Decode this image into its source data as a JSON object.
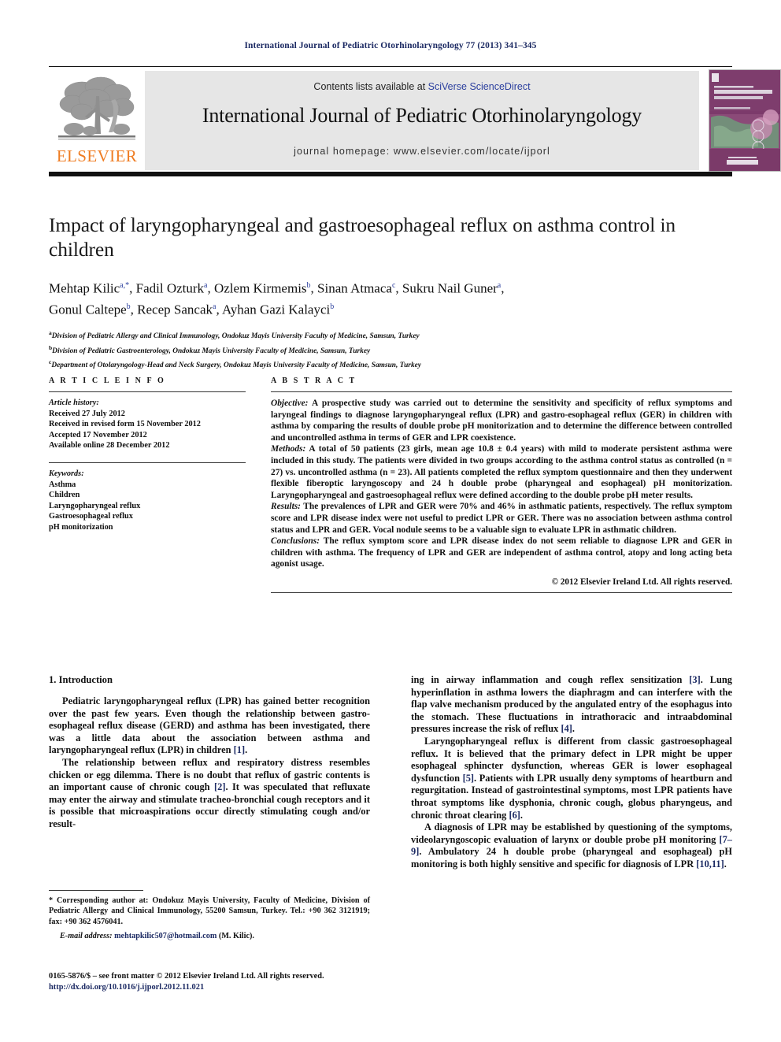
{
  "running_head": "International Journal of Pediatric Otorhinolaryngology 77 (2013) 341–345",
  "masthead": {
    "contents_prefix": "Contents lists available at ",
    "contents_link": "SciVerse ScienceDirect",
    "journal_title": "International Journal of Pediatric Otorhinolaryngology",
    "homepage": "journal homepage: www.elsevier.com/locate/ijporl",
    "publisher_wordmark": "ELSEVIER",
    "publisher_color": "#ef7c22",
    "link_color": "#2b3f9e",
    "band_color": "#e6e6e6",
    "cover_alt": "Pediatric Otorhinolaryngology journal cover"
  },
  "article": {
    "title": "Impact of laryngopharyngeal and gastroesophageal reflux on asthma control in children",
    "authors_line_1": "Mehtap Kilic a,*, Fadil Ozturk a, Ozlem Kirmemis b, Sinan Atmaca c, Sukru Nail Guner a,",
    "authors_line_2": "Gonul Caltepe b, Recep Sancak a, Ayhan Gazi Kalayci b",
    "affiliations": [
      "a Division of Pediatric Allergy and Clinical Immunology, Ondokuz Mayis University Faculty of Medicine, Samsun, Turkey",
      "b Division of Pediatric Gastroenterology, Ondokuz Mayis University Faculty of Medicine, Samsun, Turkey",
      "c Department of Otolaryngology-Head and Neck Surgery, Ondokuz Mayis University Faculty of Medicine, Samsun, Turkey"
    ]
  },
  "article_info": {
    "heading": "A R T I C L E   I N F O",
    "history_label": "Article history:",
    "history": [
      "Received 27 July 2012",
      "Received in revised form 15 November 2012",
      "Accepted 17 November 2012",
      "Available online 28 December 2012"
    ],
    "keywords_label": "Keywords:",
    "keywords": [
      "Asthma",
      "Children",
      "Laryngopharyngeal reflux",
      "Gastroesophageal reflux",
      "pH monitorization"
    ]
  },
  "abstract": {
    "heading": "A B S T R A C T",
    "objective_label": "Objective:",
    "objective_text": " A prospective study was carried out to determine the sensitivity and specificity of reflux symptoms and laryngeal findings to diagnose laryngopharyngeal reflux (LPR) and gastro-esophageal reflux (GER) in children with asthma by comparing the results of double probe pH monitorization and to determine the difference between controlled and uncontrolled asthma in terms of GER and LPR coexistence.",
    "methods_label": "Methods:",
    "methods_text": " A total of 50 patients (23 girls, mean age 10.8 ± 0.4 years) with mild to moderate persistent asthma were included in this study. The patients were divided in two groups according to the asthma control status as controlled (n = 27) vs. uncontrolled asthma (n = 23). All patients completed the reflux symptom questionnaire and then they underwent flexible fiberoptic laryngoscopy and 24 h double probe (pharyngeal and esophageal) pH monitorization. Laryngopharyngeal and gastroesophageal reflux were defined according to the double probe pH meter results.",
    "results_label": "Results:",
    "results_text": "  The prevalences of LPR and GER were 70% and 46% in asthmatic patients, respectively. The reflux symptom score and LPR disease index were not useful to predict LPR or GER. There was no association between asthma control status and LPR and GER. Vocal nodule seems to be a valuable sign to evaluate LPR in asthmatic children.",
    "conclusions_label": "Conclusions:",
    "conclusions_text": "  The reflux symptom score and LPR disease index do not seem reliable to diagnose LPR and GER in children with asthma. The frequency of LPR and GER are independent of asthma control, atopy and long acting beta agonist usage.",
    "copyright": "© 2012 Elsevier Ireland Ltd. All rights reserved."
  },
  "body": {
    "section_number_title": "1. Introduction",
    "left_paragraph_1_a": "Pediatric laryngopharyngeal reflux (LPR) has gained better recognition over the past few years. Even though the relationship between gastro-esophageal reflux disease (GERD) and asthma has been investigated, there was a little data about the association between asthma and laryngopharyngeal reflux (LPR) in children ",
    "left_paragraph_1_ref": "[1]",
    "left_paragraph_1_b": ".",
    "left_paragraph_2_a": "The relationship between reflux and respiratory distress resembles chicken or egg dilemma. There is no doubt that reflux of gastric contents is an important cause of chronic cough ",
    "left_paragraph_2_ref": "[2]",
    "left_paragraph_2_b": ". It was speculated that refluxate may enter the airway and stimulate tracheo-bronchial cough receptors and it is possible that microaspirations occur directly stimulating cough and/or result-",
    "right_paragraph_1_a": "ing in airway inflammation and cough reflex sensitization ",
    "right_paragraph_1_ref": "[3]",
    "right_paragraph_1_b": ". Lung hyperinflation in asthma lowers the diaphragm and can interfere with the flap valve mechanism produced by the angulated entry of the esophagus into the stomach. These fluctuations in intrathoracic and intraabdominal pressures increase the risk of reflux ",
    "right_paragraph_1_ref2": "[4]",
    "right_paragraph_1_c": ".",
    "right_paragraph_2_a": "Laryngopharyngeal reflux is different from classic gastroesophageal reflux. It is believed that the primary defect in LPR might be upper esophageal sphincter dysfunction, whereas GER is lower esophageal dysfunction ",
    "right_paragraph_2_ref": "[5]",
    "right_paragraph_2_b": ". Patients with LPR usually deny symptoms of heartburn and regurgitation. Instead of gastrointestinal symptoms, most LPR patients have throat symptoms like dysphonia, chronic cough, globus pharyngeus, and chronic throat clearing ",
    "right_paragraph_2_ref2": "[6]",
    "right_paragraph_2_c": ".",
    "right_paragraph_3_a": "A diagnosis of LPR may be established by questioning of the symptoms, videolaryngoscopic evaluation of larynx or double probe pH monitoring ",
    "right_paragraph_3_ref": "[7–9]",
    "right_paragraph_3_b": ". Ambulatory 24 h double probe (pharyngeal and esophageal) pH monitoring is both highly sensitive and specific for diagnosis of LPR ",
    "right_paragraph_3_ref2": "[10,11]",
    "right_paragraph_3_c": "."
  },
  "footnote": {
    "corresponding_star": "*",
    "corresponding_text": " Corresponding author at: Ondokuz Mayis University, Faculty of Medicine, Division of Pediatric Allergy and Clinical Immunology, 55200 Samsun, Turkey. Tel.: +90 362 3121919; fax: +90 362 4576041.",
    "email_label": "E-mail address:",
    "email_address": "mehtapkilic507@hotmail.com",
    "email_suffix": " (M. Kilic).",
    "front_matter": "0165-5876/$ – see front matter © 2012 Elsevier Ireland Ltd. All rights reserved.",
    "doi": "http://dx.doi.org/10.1016/j.ijporl.2012.11.021"
  }
}
